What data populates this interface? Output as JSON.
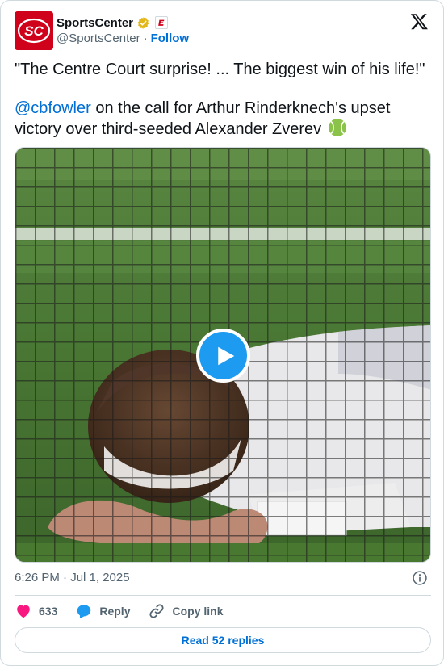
{
  "author": {
    "display_name": "SportsCenter",
    "handle": "@SportsCenter",
    "separator": "·",
    "follow_label": "Follow",
    "avatar_icon": "sportscenter-logo",
    "verified_icon": "gold-verified-badge",
    "affiliation_icon": "espn-affiliate-badge"
  },
  "tweet": {
    "quote_line": "\"The Centre Court surprise! ... The biggest win of his life!\"",
    "mention": "@cbfowler",
    "body_rest": " on the call for Arthur Rinderknech's upset victory over third-seeded Alexander Zverev",
    "emoji_icon": "tennis-ball-icon"
  },
  "media": {
    "type": "video",
    "play_icon": "play-icon"
  },
  "meta": {
    "timestamp": "6:26 PM · Jul 1, 2025"
  },
  "actions": {
    "like_count": "633",
    "reply_label": "Reply",
    "copy_label": "Copy link"
  },
  "footer": {
    "read_replies_label": "Read 52 replies"
  },
  "colors": {
    "accent": "#1d9bf0",
    "link": "#006fd6",
    "like": "#f91880",
    "brand": "#d0021b"
  }
}
